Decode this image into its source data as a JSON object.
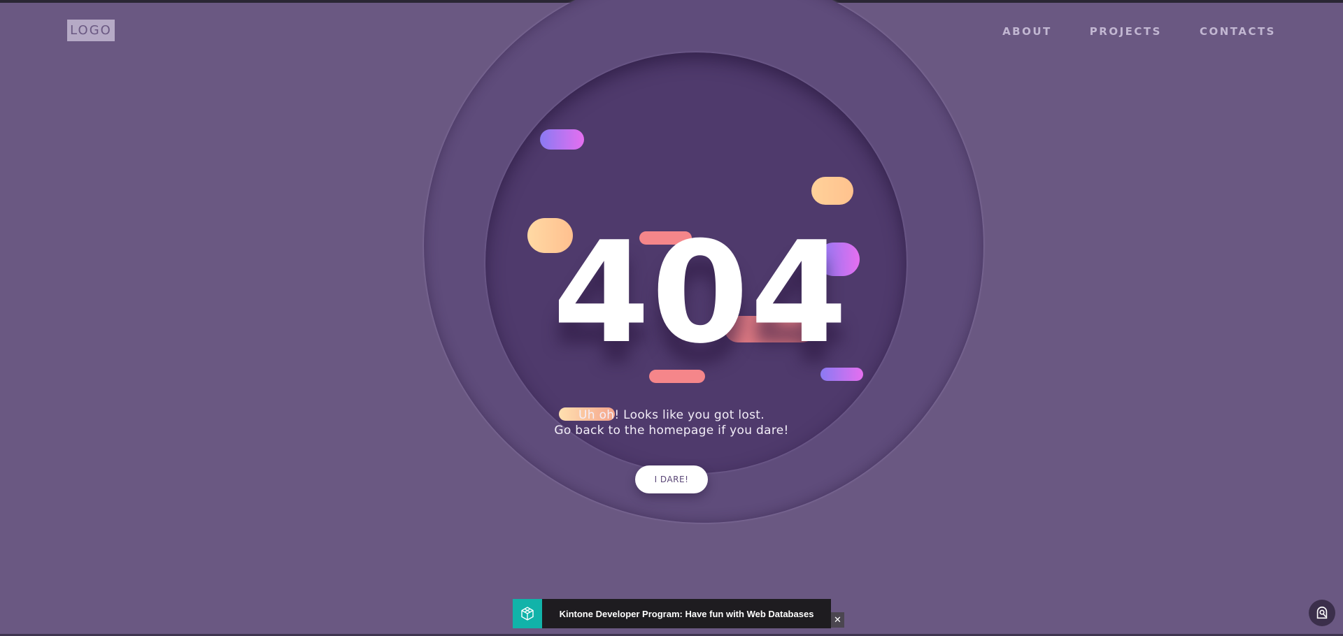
{
  "header": {
    "logo_text": "LOGO",
    "nav": [
      {
        "label": "ABOUT"
      },
      {
        "label": "PROJECTS"
      },
      {
        "label": "CONTACTS"
      }
    ]
  },
  "hero": {
    "code": "404",
    "message_line1": "Uh oh! Looks like you got lost.",
    "message_line2": "Go back to the homepage if you dare!",
    "button_label": "I DARE!"
  },
  "banner": {
    "text": "Kintone Developer Program: Have fun with Web Databases",
    "close_label": "✕"
  },
  "icons": {
    "banner_icon": "cube-icon",
    "help_icon": "help-icon"
  },
  "colors": {
    "background": "#6a5882",
    "ring_outer": "#5f4c7b",
    "ring_inner": "#4f3a6c",
    "peach": "#ffd19a",
    "coral": "#f5868a",
    "violet_gradient_start": "#8a7af2",
    "violet_gradient_end": "#e56ff0",
    "banner_accent": "#11b3a9"
  }
}
